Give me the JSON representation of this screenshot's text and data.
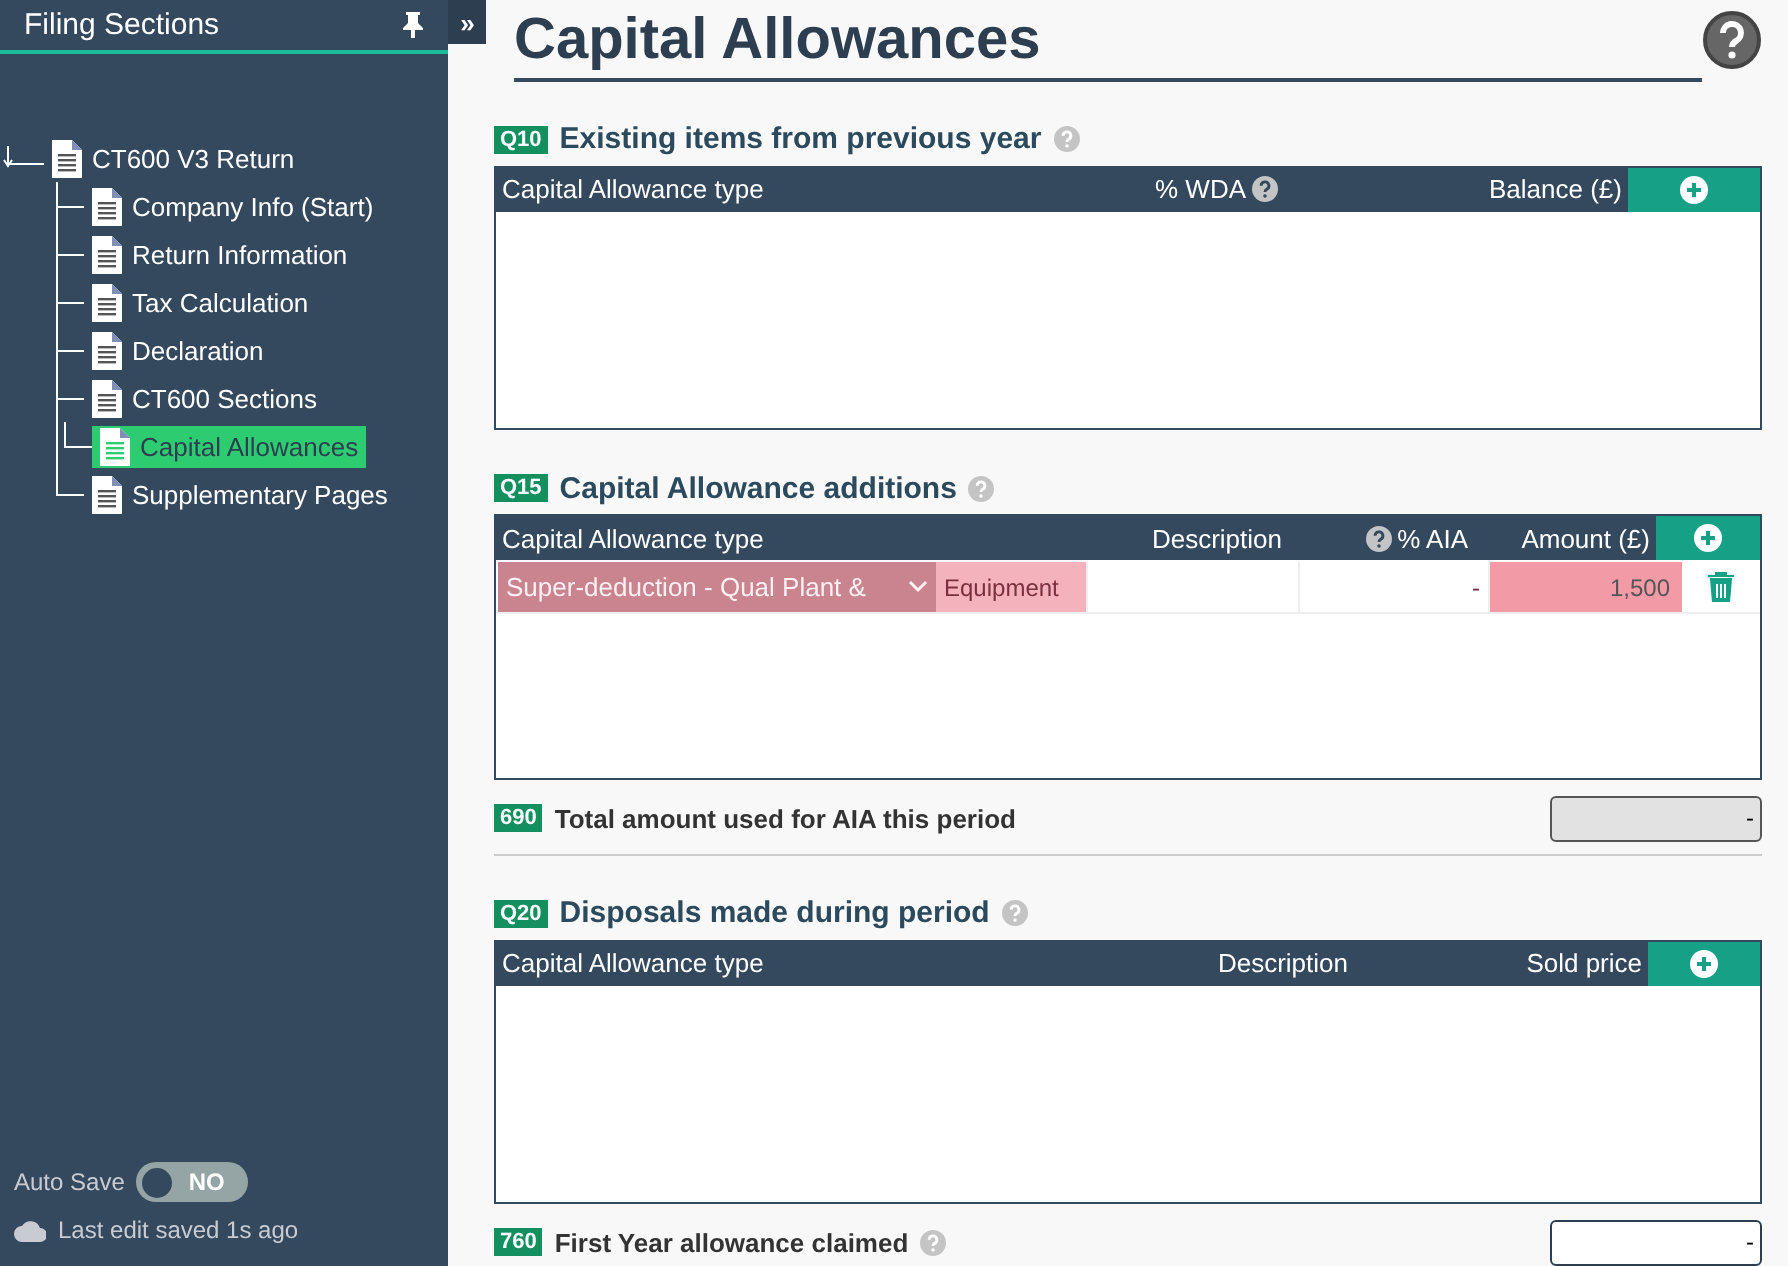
{
  "sidebar": {
    "title": "Filing Sections",
    "collapse_glyph": "»",
    "tree": [
      {
        "label": "CT600 V3 Return",
        "selected": false,
        "children": [
          {
            "label": "Company Info (Start)",
            "selected": false
          },
          {
            "label": "Return Information",
            "selected": false
          },
          {
            "label": "Tax Calculation",
            "selected": false
          },
          {
            "label": "Declaration",
            "selected": false
          },
          {
            "label": "CT600 Sections",
            "selected": false,
            "children": [
              {
                "label": "Capital Allowances",
                "selected": true
              }
            ]
          },
          {
            "label": "Supplementary Pages",
            "selected": false
          }
        ]
      }
    ],
    "auto_save": {
      "label": "Auto Save",
      "on": false,
      "state_text": "NO"
    },
    "last_saved": "Last edit saved 1s ago"
  },
  "page": {
    "title": "Capital Allowances"
  },
  "sections": [
    {
      "kind": "table",
      "code": "Q10",
      "title": "Existing items from previous year",
      "help": true,
      "columns": [
        {
          "label": "Capital Allowance type"
        },
        {
          "label": "% WDA",
          "help": true
        },
        {
          "label": "Balance (£)"
        }
      ]
    },
    {
      "kind": "table",
      "code": "Q15",
      "title": "Capital Allowance additions",
      "help": true,
      "columns": [
        {
          "label": "Capital Allowance type"
        },
        {
          "label": "Description"
        },
        {
          "label": "% AIA",
          "help": true,
          "help_first": true
        },
        {
          "label": "Amount (£)"
        }
      ],
      "rows": [
        {
          "type": "Super-deduction - Qual Plant &",
          "description": "Equipment",
          "aia": "-",
          "amount": "1,500",
          "invalid": true
        }
      ]
    },
    {
      "kind": "total",
      "code": "690",
      "title": "Total amount used for AIA this period",
      "help": false,
      "value": "-",
      "readonly": true
    },
    {
      "kind": "table",
      "code": "Q20",
      "title": "Disposals made during period",
      "help": true,
      "columns": [
        {
          "label": "Capital Allowance type"
        },
        {
          "label": "Description"
        },
        {
          "label": "Sold price"
        }
      ]
    },
    {
      "kind": "total",
      "code": "760",
      "title": "First Year allowance claimed",
      "help": true,
      "value": "-",
      "readonly": false
    }
  ]
}
